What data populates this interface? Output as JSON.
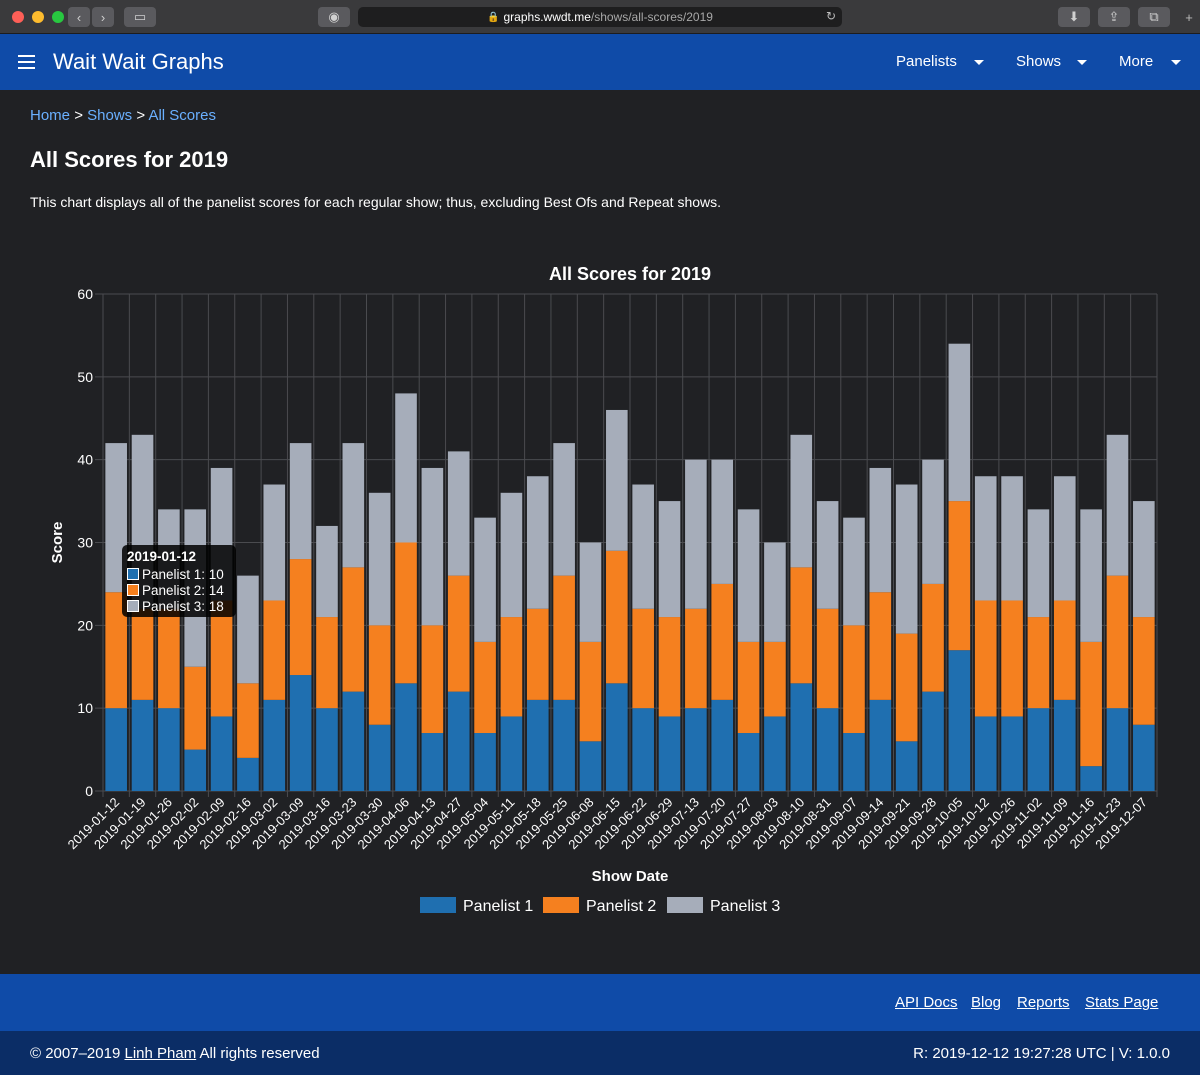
{
  "browser": {
    "url_host": "graphs.wwdt.me",
    "url_path": "/shows/all-scores/2019"
  },
  "navbar": {
    "brand": "Wait Wait Graphs",
    "items": [
      {
        "label": "Panelists"
      },
      {
        "label": "Shows"
      },
      {
        "label": "More"
      }
    ]
  },
  "breadcrumb": {
    "home": "Home",
    "sep1": ">",
    "shows": "Shows",
    "sep2": ">",
    "current": "All Scores"
  },
  "page": {
    "title": "All Scores for 2019",
    "description": "This chart displays all of the panelist scores for each regular show; thus, excluding Best Ofs and Repeat shows."
  },
  "colors": {
    "panelist1": "#1f6fb0",
    "panelist2": "#f5801f",
    "panelist3": "#a6adba",
    "grid": "#4a4b4f"
  },
  "tooltip": {
    "title": "2019-01-12",
    "rows": [
      {
        "label": "Panelist 1: 10"
      },
      {
        "label": "Panelist 2: 14"
      },
      {
        "label": "Panelist 3: 18"
      }
    ]
  },
  "chart_data": {
    "type": "bar",
    "stacked": true,
    "title": "All Scores for 2019",
    "xlabel": "Show Date",
    "ylabel": "Score",
    "ylim": [
      0,
      60
    ],
    "yticks": [
      0,
      10,
      20,
      30,
      40,
      50,
      60
    ],
    "grid": true,
    "legend": "bottom",
    "categories": [
      "2019-01-12",
      "2019-01-19",
      "2019-01-26",
      "2019-02-02",
      "2019-02-09",
      "2019-02-16",
      "2019-03-02",
      "2019-03-09",
      "2019-03-16",
      "2019-03-23",
      "2019-03-30",
      "2019-04-06",
      "2019-04-13",
      "2019-04-27",
      "2019-05-04",
      "2019-05-11",
      "2019-05-18",
      "2019-05-25",
      "2019-06-08",
      "2019-06-15",
      "2019-06-22",
      "2019-06-29",
      "2019-07-13",
      "2019-07-20",
      "2019-07-27",
      "2019-08-03",
      "2019-08-10",
      "2019-08-31",
      "2019-09-07",
      "2019-09-14",
      "2019-09-21",
      "2019-09-28",
      "2019-10-05",
      "2019-10-12",
      "2019-10-26",
      "2019-11-02",
      "2019-11-09",
      "2019-11-16",
      "2019-11-23",
      "2019-12-07"
    ],
    "series": [
      {
        "name": "Panelist 1",
        "values": [
          10,
          11,
          10,
          5,
          9,
          4,
          11,
          14,
          10,
          12,
          8,
          13,
          7,
          12,
          7,
          9,
          11,
          11,
          6,
          13,
          10,
          9,
          10,
          11,
          7,
          9,
          13,
          10,
          7,
          11,
          6,
          12,
          17,
          9,
          9,
          10,
          11,
          3,
          10,
          8
        ]
      },
      {
        "name": "Panelist 2",
        "values": [
          14,
          11,
          12,
          10,
          14,
          9,
          12,
          14,
          11,
          15,
          12,
          17,
          13,
          14,
          11,
          12,
          11,
          15,
          12,
          16,
          12,
          12,
          12,
          14,
          11,
          9,
          14,
          12,
          13,
          13,
          13,
          13,
          18,
          14,
          14,
          11,
          12,
          15,
          16,
          13
        ]
      },
      {
        "name": "Panelist 3",
        "values": [
          18,
          21,
          12,
          19,
          16,
          13,
          14,
          14,
          11,
          15,
          16,
          18,
          19,
          15,
          15,
          15,
          16,
          16,
          12,
          17,
          15,
          14,
          18,
          15,
          16,
          12,
          16,
          13,
          13,
          15,
          18,
          15,
          19,
          15,
          15,
          13,
          15,
          16,
          17,
          14
        ]
      }
    ]
  },
  "footer": {
    "links": [
      {
        "label": "API Docs"
      },
      {
        "label": "Blog"
      },
      {
        "label": "Reports"
      },
      {
        "label": "Stats Page"
      }
    ],
    "copyright_prefix": "© 2007–2019",
    "author": "Linh Pham",
    "rights": "All rights reserved",
    "revision": "R: 2019-12-12 19:27:28 UTC | V: 1.0.0"
  }
}
